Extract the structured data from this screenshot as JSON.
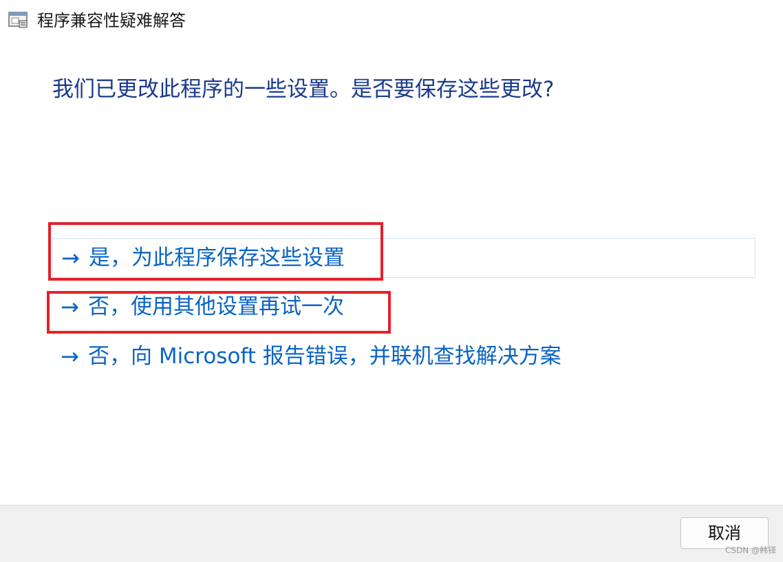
{
  "window": {
    "title": "程序兼容性疑难解答",
    "icon": "compatibility-troubleshooter-icon"
  },
  "main": {
    "heading": "我们已更改此程序的一些设置。是否要保存这些更改?",
    "options": [
      {
        "arrow": "→",
        "label": "是，为此程序保存这些设置",
        "highlighted": true,
        "hovered": true
      },
      {
        "arrow": "→",
        "label": "否，使用其他设置再试一次",
        "highlighted": true,
        "hovered": false
      },
      {
        "arrow": "→",
        "label": "否，向 Microsoft 报告错误，并联机查找解决方案",
        "highlighted": false,
        "hovered": false
      }
    ]
  },
  "footer": {
    "cancel_label": "取消"
  },
  "watermark": "CSDN @韩铎",
  "colors": {
    "heading": "#1a3a8c",
    "link": "#0a64c2",
    "annotation": "#e5202a",
    "hover_border": "#cfe3f3",
    "footer_bg": "#f0f0f0"
  }
}
